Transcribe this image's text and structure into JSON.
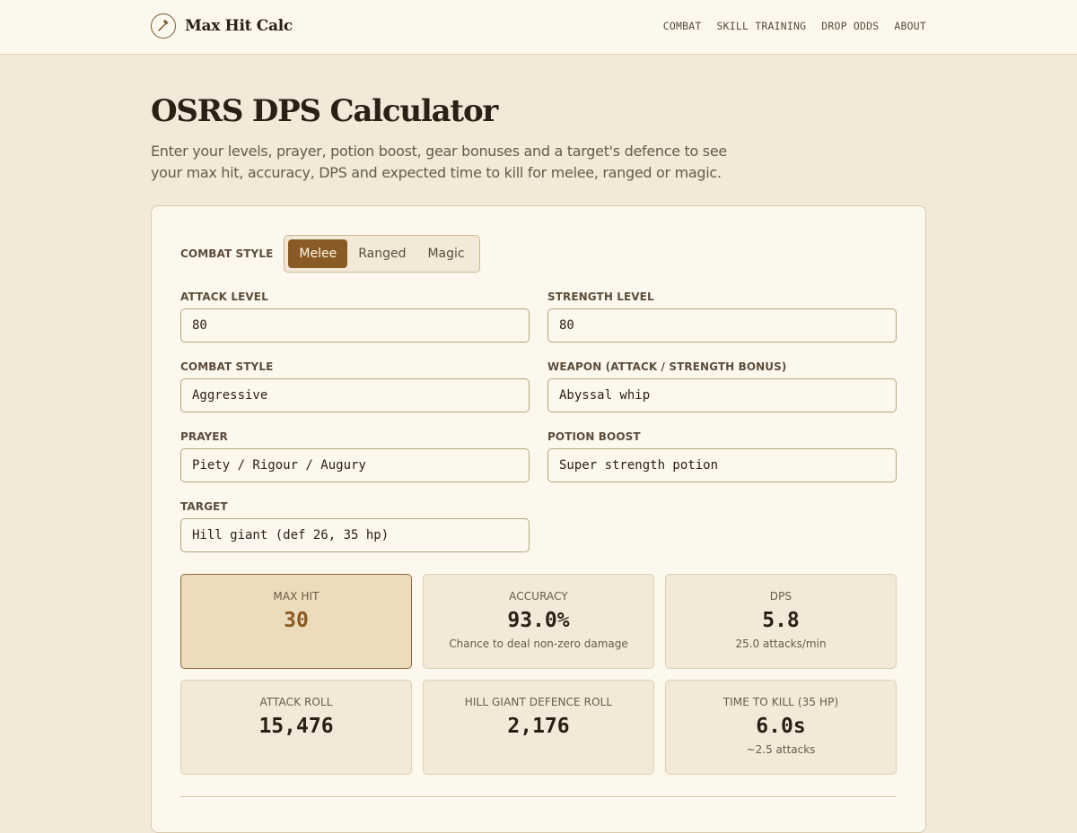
{
  "header": {
    "brand": "Max Hit Calc",
    "nav": [
      "COMBAT",
      "SKILL TRAINING",
      "DROP ODDS",
      "ABOUT"
    ]
  },
  "hero": {
    "title": "OSRS DPS Calculator",
    "description": "Enter your levels, prayer, potion boost, gear bonuses and a target's defence to see your max hit, accuracy, DPS and expected time to kill for melee, ranged or magic."
  },
  "form": {
    "combat_style_label": "COMBAT STYLE",
    "style_tabs": [
      "Melee",
      "Ranged",
      "Magic"
    ],
    "active_style": "Melee",
    "fields": [
      {
        "label": "ATTACK LEVEL",
        "value": "80"
      },
      {
        "label": "STRENGTH LEVEL",
        "value": "80"
      },
      {
        "label": "COMBAT STYLE",
        "value": "Aggressive"
      },
      {
        "label": "WEAPON (ATTACK / STRENGTH BONUS)",
        "value": "Abyssal whip"
      },
      {
        "label": "PRAYER",
        "value": "Piety / Rigour / Augury"
      },
      {
        "label": "POTION BOOST",
        "value": "Super strength potion"
      },
      {
        "label": "TARGET",
        "value": "Hill giant (def 26, 35 hp)"
      }
    ]
  },
  "results": [
    {
      "label": "MAX HIT",
      "value": "30",
      "sub": ""
    },
    {
      "label": "ACCURACY",
      "value": "93.0%",
      "sub": "Chance to deal non-zero damage"
    },
    {
      "label": "DPS",
      "value": "5.8",
      "sub": "25.0 attacks/min"
    },
    {
      "label": "ATTACK ROLL",
      "value": "15,476",
      "sub": ""
    },
    {
      "label": "HILL GIANT DEFENCE ROLL",
      "value": "2,176",
      "sub": ""
    },
    {
      "label": "TIME TO KILL (35 HP)",
      "value": "6.0s",
      "sub": "~2.5 attacks"
    }
  ],
  "colors": {
    "background": "#f2e9d8",
    "surface": "#fdf8ee",
    "accent": "#8a5a24",
    "text": "#2a2016"
  },
  "icons": {
    "brand": "hammer-icon"
  }
}
